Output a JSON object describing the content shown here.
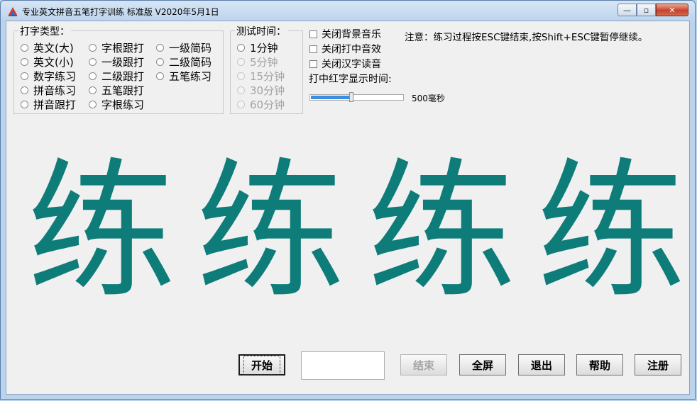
{
  "window": {
    "title": "专业英文拼音五笔打字训练  标准版  V2020年5月1日",
    "minimize_glyph": "—",
    "maximize_glyph": "▫",
    "close_glyph": "✕"
  },
  "typing_type": {
    "label": "打字类型：",
    "options": [
      "英文(大)",
      "英文(小)",
      "数字练习",
      "拼音练习",
      "拼音跟打",
      "字根跟打",
      "一级跟打",
      "二级跟打",
      "五笔跟打",
      "字根练习",
      "一级简码",
      "二级简码",
      "五笔练习"
    ]
  },
  "test_time": {
    "label": "测试时间：",
    "options": [
      "1分钟",
      "5分钟",
      "15分钟",
      "30分钟",
      "60分钟"
    ]
  },
  "settings": {
    "bg_music": "关闭背景音乐",
    "hit_sound": "关闭打中音效",
    "char_voice": "关闭汉字读音",
    "display_time_label": "打中红字显示时间:",
    "display_time_value": "500毫秒",
    "display_time_fraction": 0.42
  },
  "notice": "注意：练习过程按ESC键结束,按Shift+ESC键暂停继续。",
  "practice_chars": [
    "练",
    "练",
    "练",
    "练"
  ],
  "buttons": {
    "start": "开始",
    "end": "结束",
    "fullscreen": "全屏",
    "exit": "退出",
    "help": "帮助",
    "register": "注册"
  },
  "input_value": "",
  "colors": {
    "practice_char": "#0e7d7a",
    "slider_fill": "#3c8ee0"
  }
}
